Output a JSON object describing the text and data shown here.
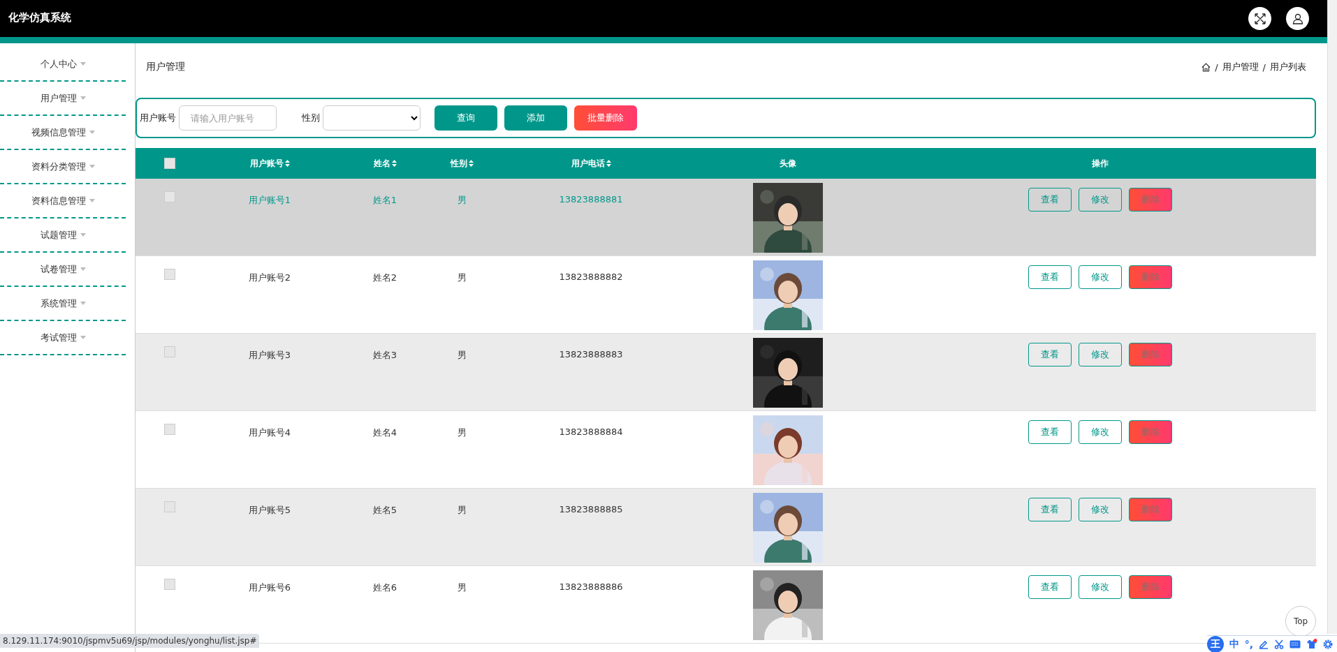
{
  "app_title": "化学仿真系统",
  "sidebar": {
    "items": [
      {
        "label": "个人中心"
      },
      {
        "label": "用户管理"
      },
      {
        "label": "视频信息管理"
      },
      {
        "label": "资料分类管理"
      },
      {
        "label": "资料信息管理"
      },
      {
        "label": "试题管理"
      },
      {
        "label": "试卷管理"
      },
      {
        "label": "系统管理"
      },
      {
        "label": "考试管理"
      }
    ]
  },
  "page_title": "用户管理",
  "breadcrumb": [
    {
      "separator": "/",
      "label": "用户管理"
    },
    {
      "separator": "/",
      "label": "用户列表"
    }
  ],
  "search": {
    "account_label": "用户账号",
    "account_placeholder": "请输入用户账号",
    "gender_label": "性别",
    "buttons": [
      {
        "label": "查询",
        "kind": "primary"
      },
      {
        "label": "添加",
        "kind": "primary"
      },
      {
        "label": "批量删除",
        "kind": "danger"
      }
    ]
  },
  "table": {
    "select_all_checked": false,
    "columns": [
      {
        "label": "用户账号",
        "sortable": true
      },
      {
        "label": "姓名",
        "sortable": true
      },
      {
        "label": "性别",
        "sortable": true
      },
      {
        "label": "用户电话",
        "sortable": true
      },
      {
        "label": "头像",
        "sortable": false
      },
      {
        "label": "操作",
        "sortable": false
      }
    ],
    "rows": [
      {
        "checked": false,
        "highlighted": true,
        "account": "用户账号1",
        "name": "姓名1",
        "gender": "男",
        "phone": "13823888881",
        "actions": [
          "查看",
          "修改",
          "删除"
        ]
      },
      {
        "checked": false,
        "highlighted": false,
        "account": "用户账号2",
        "name": "姓名2",
        "gender": "男",
        "phone": "13823888882",
        "actions": [
          "查看",
          "修改",
          "删除"
        ]
      },
      {
        "checked": false,
        "highlighted": false,
        "account": "用户账号3",
        "name": "姓名3",
        "gender": "男",
        "phone": "13823888883",
        "actions": [
          "查看",
          "修改",
          "删除"
        ]
      },
      {
        "checked": false,
        "highlighted": false,
        "account": "用户账号4",
        "name": "姓名4",
        "gender": "男",
        "phone": "13823888884",
        "actions": [
          "查看",
          "修改",
          "删除"
        ]
      },
      {
        "checked": false,
        "highlighted": false,
        "account": "用户账号5",
        "name": "姓名5",
        "gender": "男",
        "phone": "13823888885",
        "actions": [
          "查看",
          "修改",
          "删除"
        ]
      },
      {
        "checked": false,
        "highlighted": false,
        "account": "用户账号6",
        "name": "姓名6",
        "gender": "男",
        "phone": "13823888886",
        "actions": [
          "查看",
          "修改",
          "删除"
        ]
      }
    ]
  },
  "back_to_top": "Top",
  "status_url": "8.129.11.174:9010/jspmv5u69/jsp/modules/yonghu/list.jsp#",
  "ime_toolbar": {
    "logo": "王",
    "mode": "中",
    "punct": "°,"
  }
}
